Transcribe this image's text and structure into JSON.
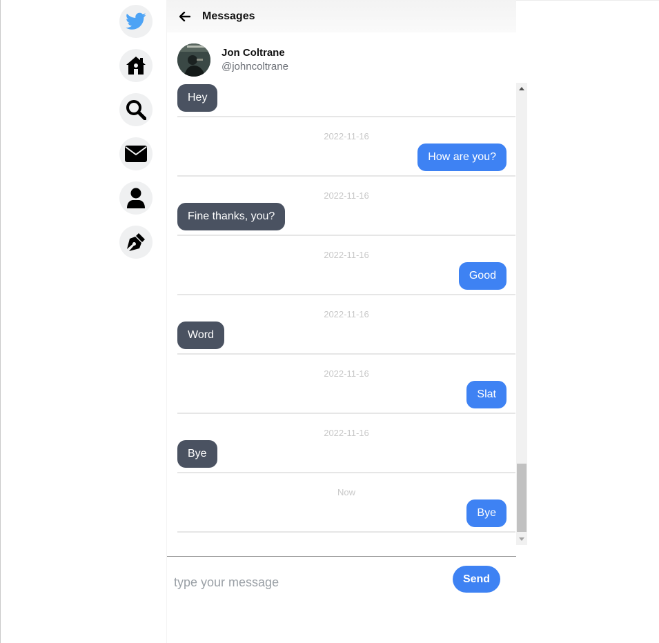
{
  "header": {
    "title": "Messages"
  },
  "contact": {
    "name": "Jon Coltrane",
    "handle": "@johncoltrane"
  },
  "sidebar": {
    "items": [
      {
        "icon": "twitter-bird-icon",
        "color": "#4da3f5"
      },
      {
        "icon": "home-icon"
      },
      {
        "icon": "search-icon"
      },
      {
        "icon": "envelope-icon"
      },
      {
        "icon": "user-icon"
      },
      {
        "icon": "pen-nib-icon"
      }
    ]
  },
  "messages": [
    {
      "date": "",
      "text": "Hey",
      "from": "them"
    },
    {
      "date": "2022-11-16",
      "text": "How are you?",
      "from": "me"
    },
    {
      "date": "2022-11-16",
      "text": "Fine thanks, you?",
      "from": "them"
    },
    {
      "date": "2022-11-16",
      "text": "Good",
      "from": "me"
    },
    {
      "date": "2022-11-16",
      "text": "Word",
      "from": "them"
    },
    {
      "date": "2022-11-16",
      "text": "Slat",
      "from": "me"
    },
    {
      "date": "2022-11-16",
      "text": "Bye",
      "from": "them"
    },
    {
      "date": "Now",
      "text": "Bye",
      "from": "me"
    }
  ],
  "composer": {
    "placeholder": "type your message",
    "value": "",
    "send_label": "Send"
  },
  "colors": {
    "my_bubble": "#3e82f3",
    "their_bubble": "#4a5261",
    "accent": "#3e82f3"
  }
}
